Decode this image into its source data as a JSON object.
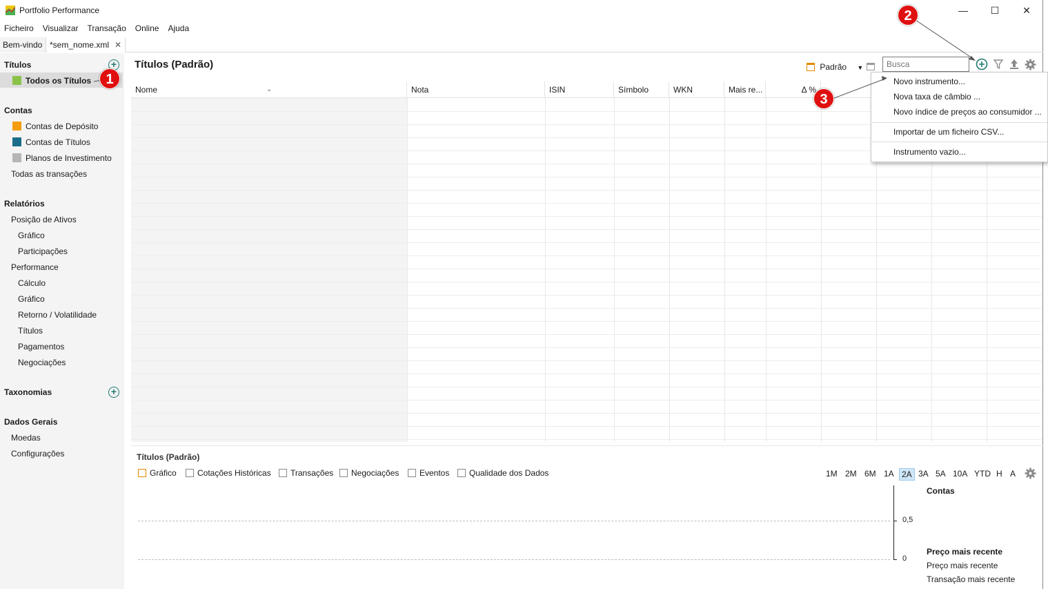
{
  "window": {
    "title": "Portfolio Performance",
    "controls": {
      "minimize": "—",
      "maximize": "☐",
      "close": "✕"
    }
  },
  "menubar": [
    "Ficheiro",
    "Visualizar",
    "Transação",
    "Online",
    "Ajuda"
  ],
  "tabs": [
    {
      "label": "Bem-vindo"
    },
    {
      "label": "*sem_nome.xml",
      "close": "✕"
    }
  ],
  "sidebar": {
    "titulos": {
      "header": "Títulos",
      "items": [
        "Todos os Títulos"
      ]
    },
    "contas": {
      "header": "Contas",
      "items": [
        "Contas de Depósito",
        "Contas de Títulos",
        "Planos de Investimento",
        "Todas as transações"
      ]
    },
    "relatorios": {
      "header": "Relatórios",
      "items": [
        "Posição de Ativos",
        "Gráfico",
        "Participações",
        "Performance",
        "Cálculo",
        "Gráfico",
        "Retorno / Volatilidade",
        "Títulos",
        "Pagamentos",
        "Negociações"
      ]
    },
    "taxonomias": {
      "header": "Taxonomias"
    },
    "dados_gerais": {
      "header": "Dados Gerais",
      "items": [
        "Moedas",
        "Configurações"
      ]
    },
    "colors": {
      "green": "#8bc34a",
      "orange": "#f39c12",
      "teal": "#1a6e8a",
      "gray": "#b5b5b5",
      "accent": "#1e7a72"
    }
  },
  "main": {
    "title": "Títulos (Padrão)",
    "view_selector": "Padrão",
    "search_placeholder": "Busca",
    "columns": [
      "Nome",
      "Nota",
      "ISIN",
      "Símbolo",
      "WKN",
      "Mais re...",
      "Δ %"
    ]
  },
  "new_menu": {
    "items": [
      "Novo instrumento...",
      "Nova taxa de câmbio ...",
      "Novo índice de preços ao consumidor ...",
      "Importar de um ficheiro CSV...",
      "Instrumento vazio..."
    ]
  },
  "annotations": [
    "1",
    "2",
    "3"
  ],
  "bottom": {
    "title": "Títulos (Padrão)",
    "tabs": [
      "Gráfico",
      "Cotações Históricas",
      "Transações",
      "Negociações",
      "Eventos",
      "Qualidade dos Dados"
    ],
    "periods": [
      "1M",
      "2M",
      "6M",
      "1A",
      "2A",
      "3A",
      "5A",
      "10A",
      "YTD",
      "H",
      "A"
    ],
    "selected_period": "2A",
    "axis_ticks": [
      "0,5",
      "0"
    ],
    "legend": {
      "contas": "Contas",
      "preco_header": "Preço mais recente",
      "preco": "Preço mais recente",
      "transacao": "Transação mais recente"
    }
  }
}
